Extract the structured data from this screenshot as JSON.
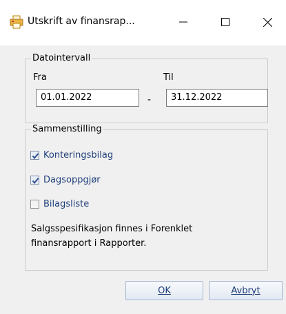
{
  "window": {
    "title": "Utskrift av finansrap...",
    "icon": "printer-icon",
    "controls": {
      "minimize": "minimize-icon",
      "maximize": "maximize-icon",
      "close": "close-icon"
    }
  },
  "date_interval": {
    "legend": "Datointervall",
    "from_label": "Fra",
    "from_value": "01.01.2022",
    "separator": "-",
    "to_label": "Til",
    "to_value": "31.12.2022"
  },
  "summary": {
    "legend": "Sammenstilling",
    "options": [
      {
        "label": "Konteringsbilag",
        "checked": true
      },
      {
        "label": "Dagsoppgjør",
        "checked": true
      },
      {
        "label": "Bilagsliste",
        "checked": false
      }
    ],
    "info_line1": "Salgsspesifikasjon finnes i Forenklet",
    "info_line2": "finansrapport i Rapporter."
  },
  "buttons": {
    "ok": "OK",
    "cancel": "Avbryt"
  },
  "colors": {
    "accent_text": "#1f3f7a",
    "dialog_bg": "#f0f0f0",
    "button_border": "#a5b7d2"
  }
}
